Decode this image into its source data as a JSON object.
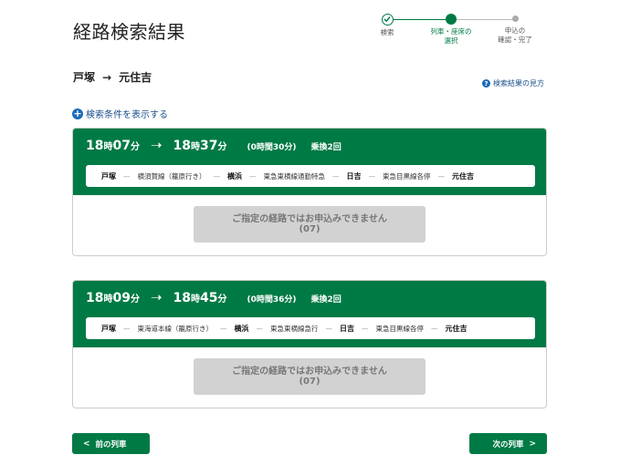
{
  "page": {
    "title": "経路検索結果"
  },
  "stepper": {
    "steps": [
      {
        "label_1": "検索",
        "label_2": "",
        "state": "done"
      },
      {
        "label_1": "列車・座席の",
        "label_2": "選択",
        "state": "current"
      },
      {
        "label_1": "申込の",
        "label_2": "確認・完了",
        "state": "todo"
      }
    ]
  },
  "route": {
    "from": "戸塚",
    "arrow": "→",
    "to": "元住吉"
  },
  "help_link": {
    "icon": "question-circle-icon",
    "label": "検索結果の見方"
  },
  "show_conditions": {
    "icon": "plus-circle-icon",
    "label": "検索条件を表示する"
  },
  "results": [
    {
      "dep_hour": "18",
      "dep_min": "07",
      "arr_hour": "18",
      "arr_min": "37",
      "hour_unit": "時",
      "min_unit": "分",
      "arrow": "➝",
      "duration": "(0時間30分)",
      "transfers": "乗換2回",
      "segments": [
        {
          "station": "戸塚",
          "line": "横須賀線（籠原行き）"
        },
        {
          "station": "横浜",
          "line": "東急東横線通勤特急"
        },
        {
          "station": "日吉",
          "line": "東急目黒線各停"
        },
        {
          "station": "元住吉",
          "line": ""
        }
      ],
      "status_line_1": "ご指定の経路ではお申込みできません",
      "status_line_2": "(07)"
    },
    {
      "dep_hour": "18",
      "dep_min": "09",
      "arr_hour": "18",
      "arr_min": "45",
      "hour_unit": "時",
      "min_unit": "分",
      "arrow": "➝",
      "duration": "(0時間36分)",
      "transfers": "乗換2回",
      "segments": [
        {
          "station": "戸塚",
          "line": "東海道本線（籠原行き）"
        },
        {
          "station": "横浜",
          "line": "東急東横線急行"
        },
        {
          "station": "日吉",
          "line": "東急目黒線各停"
        },
        {
          "station": "元住吉",
          "line": ""
        }
      ],
      "status_line_1": "ご指定の経路ではお申込みできません",
      "status_line_2": "(07)"
    }
  ],
  "nav": {
    "prev_label": "前の列車",
    "next_label": "次の列車",
    "prev_icon": "chevron-left-icon",
    "next_icon": "chevron-right-icon"
  },
  "colors": {
    "brand_green": "#007a45",
    "link_blue": "#1a4f8b",
    "disabled_gray": "#d2d2d2"
  }
}
